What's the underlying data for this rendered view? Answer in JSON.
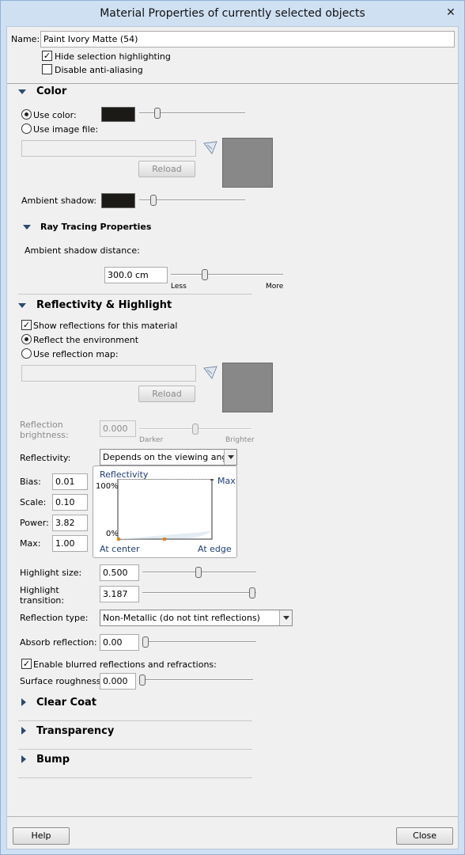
{
  "window": {
    "title": "Material Properties of currently selected objects",
    "close_glyph": "✕"
  },
  "name_row": {
    "label": "Name:",
    "value": "Paint Ivory Matte (54)"
  },
  "options": {
    "hide_selection_label": "Hide selection highlighting",
    "hide_selection_checked": true,
    "disable_aa_label": "Disable anti-aliasing",
    "disable_aa_checked": false
  },
  "color_section": {
    "title": "Color",
    "use_color_label": "Use color:",
    "use_image_label": "Use image file:",
    "reload_label": "Reload",
    "ambient_shadow_label": "Ambient shadow:",
    "swatch_color": "#1c1a17",
    "preview_color": "#888888"
  },
  "ray_tracing": {
    "title": "Ray Tracing Properties",
    "distance_label": "Ambient shadow distance:",
    "distance_value": "300.0 cm",
    "less_label": "Less",
    "more_label": "More"
  },
  "reflectivity_section": {
    "title": "Reflectivity & Highlight",
    "show_reflections_label": "Show reflections for this material",
    "reflect_env_label": "Reflect the environment",
    "use_map_label": "Use reflection map:",
    "reload_label": "Reload",
    "brightness_label_1": "Reflection",
    "brightness_label_2": "brightness:",
    "brightness_value": "0.000",
    "darker_label": "Darker",
    "brighter_label": "Brighter",
    "reflectivity_label": "Reflectivity:",
    "reflectivity_value": "Depends on the viewing angle",
    "bias_label": "Bias:",
    "bias_value": "0.01",
    "scale_label": "Scale:",
    "scale_value": "0.10",
    "power_label": "Power:",
    "power_value": "3.82",
    "max_label": "Max:",
    "max_value": "1.00",
    "graph": {
      "title": "Reflectivity",
      "y_top": "100%",
      "y_bottom": "0%",
      "max_label": "Max",
      "x_left": "At center",
      "x_right": "At edge"
    },
    "highlight_size_label": "Highlight size:",
    "highlight_size_value": "0.500",
    "highlight_transition_label_1": "Highlight",
    "highlight_transition_label_2": "transition:",
    "highlight_transition_value": "3.187",
    "reflection_type_label": "Reflection type:",
    "reflection_type_value": "Non-Metallic (do not tint reflections)",
    "absorb_label": "Absorb reflection:",
    "absorb_value": "0.00",
    "blurred_label": "Enable blurred reflections and refractions:",
    "roughness_label": "Surface roughness:",
    "roughness_value": "0.000"
  },
  "collapsed_sections": {
    "clear_coat": "Clear Coat",
    "transparency": "Transparency",
    "bump": "Bump"
  },
  "footer": {
    "help_label": "Help",
    "close_label": "Close"
  }
}
